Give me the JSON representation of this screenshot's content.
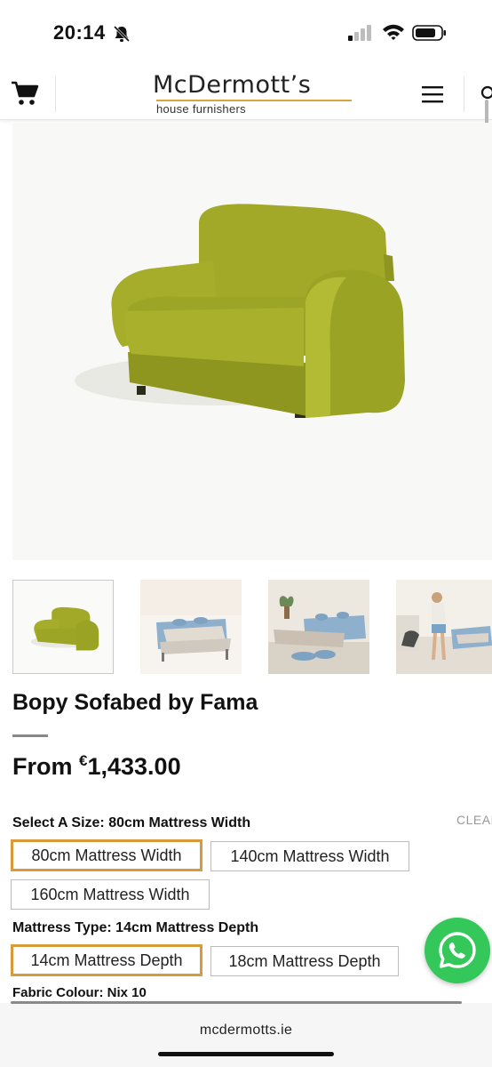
{
  "status_bar": {
    "time": "20:14"
  },
  "header": {
    "brand_name": "McDermott’s",
    "brand_tagline": "house furnishers",
    "accent_color": "#d6a53c"
  },
  "product": {
    "title": "Bopy Sofabed by Fama",
    "price_prefix": "From ",
    "currency": "€",
    "price": "1,433.00",
    "sofa_color": "#a7ae2a"
  },
  "thumbnails": [
    {
      "name": "sofabed-closed-thumbnail"
    },
    {
      "name": "sofabed-open-thumbnail"
    },
    {
      "name": "sofabed-room-thumbnail"
    },
    {
      "name": "sofabed-person-thumbnail"
    }
  ],
  "options": {
    "size_label": "Select A Size: 80cm Mattress Width",
    "clear": "CLEAR",
    "sizes": [
      "80cm Mattress Width",
      "140cm Mattress Width",
      "160cm Mattress Width"
    ],
    "selected_size": "80cm Mattress Width",
    "mattress_label": "Mattress Type: 14cm Mattress Depth",
    "depths": [
      "14cm Mattress Depth",
      "18cm Mattress Depth"
    ],
    "selected_depth": "14cm Mattress Depth",
    "fabric_label": "Fabric Colour: Nix 10",
    "selected_border_color": "#d99a3b"
  },
  "whatsapp": {
    "icon": "whatsapp-icon",
    "color": "#34c759"
  },
  "browser": {
    "url": "mcdermotts.ie"
  }
}
